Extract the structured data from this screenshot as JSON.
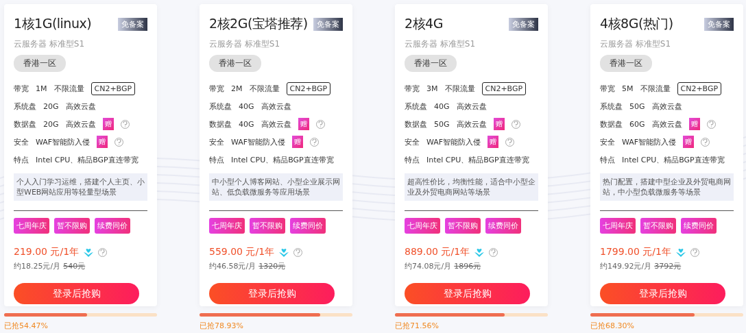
{
  "plans": [
    {
      "title": "1核1G(linux)",
      "badge": "免备案",
      "subtitle": "云服务器 标准型S1",
      "region": "香港一区",
      "specs": [
        {
          "label": "带宽",
          "value": "1M",
          "note": "不限流量",
          "tag": "CN2+BGP"
        },
        {
          "label": "系统盘",
          "value": "20G",
          "note": "高效云盘"
        },
        {
          "label": "数据盘",
          "value": "20G",
          "note": "高效云盘",
          "gift": "赠"
        },
        {
          "label": "安全",
          "value": "WAF智能防入侵",
          "gift": "赠"
        },
        {
          "label": "特点",
          "value": "Intel CPU、精品BGP直连带宽"
        }
      ],
      "description": "个人入门学习运维，搭建个人主页、小型WEB网站应用等轻量型场景",
      "promos": [
        "七周年庆",
        "暂不限购",
        "续费同价"
      ],
      "price": "219.00 元/1年",
      "monthly": "约18.25元/月",
      "original": "540元",
      "button": "登录后抢购",
      "level": 0.5447,
      "sold": "已抢54.47%"
    },
    {
      "title": "2核2G(宝塔推荐)",
      "badge": "免备案",
      "subtitle": "云服务器 标准型S1",
      "region": "香港一区",
      "specs": [
        {
          "label": "带宽",
          "value": "2M",
          "note": "不限流量",
          "tag": "CN2+BGP"
        },
        {
          "label": "系统盘",
          "value": "40G",
          "note": "高效云盘"
        },
        {
          "label": "数据盘",
          "value": "40G",
          "note": "高效云盘",
          "gift": "赠"
        },
        {
          "label": "安全",
          "value": "WAF智能防入侵",
          "gift": "赠"
        },
        {
          "label": "特点",
          "value": "Intel CPU、精品BGP直连带宽"
        }
      ],
      "description": "中小型个人博客网站、小型企业展示网站、低负载微服务等应用场景",
      "promos": [
        "七周年庆",
        "暂不限购",
        "续费同价"
      ],
      "price": "559.00 元/1年",
      "monthly": "约46.58元/月",
      "original": "1320元",
      "button": "登录后抢购",
      "level": 0.7893,
      "sold": "已抢78.93%"
    },
    {
      "title": "2核4G",
      "badge": "免备案",
      "subtitle": "云服务器 标准型S1",
      "region": "香港一区",
      "specs": [
        {
          "label": "带宽",
          "value": "3M",
          "note": "不限流量",
          "tag": "CN2+BGP"
        },
        {
          "label": "系统盘",
          "value": "40G",
          "note": "高效云盘"
        },
        {
          "label": "数据盘",
          "value": "50G",
          "note": "高效云盘",
          "gift": "赠"
        },
        {
          "label": "安全",
          "value": "WAF智能防入侵",
          "gift": "赠"
        },
        {
          "label": "特点",
          "value": "Intel CPU、精品BGP直连带宽"
        }
      ],
      "description": "超高性价比，均衡性能，适合中小型企业及外贸电商网站等场景",
      "promos": [
        "七周年庆",
        "暂不限购",
        "续费同价"
      ],
      "price": "889.00 元/1年",
      "monthly": "约74.08元/月",
      "original": "1896元",
      "button": "登录后抢购",
      "level": 0.7156,
      "sold": "已抢71.56%"
    },
    {
      "title": "4核8G(热门)",
      "badge": "免备案",
      "subtitle": "云服务器 标准型S1",
      "region": "香港一区",
      "specs": [
        {
          "label": "带宽",
          "value": "5M",
          "note": "不限流量",
          "tag": "CN2+BGP"
        },
        {
          "label": "系统盘",
          "value": "50G",
          "note": "高效云盘"
        },
        {
          "label": "数据盘",
          "value": "60G",
          "note": "高效云盘",
          "gift": "赠"
        },
        {
          "label": "安全",
          "value": "WAF智能防入侵",
          "gift": "赠"
        },
        {
          "label": "特点",
          "value": "Intel CPU、精品BGP直连带宽"
        }
      ],
      "description": "热门配置，搭建中型企业及外贸电商网站，中小型负载微服务等场景",
      "promos": [
        "七周年庆",
        "暂不限购",
        "续费同价"
      ],
      "price": "1799.00 元/1年",
      "monthly": "约149.92元/月",
      "original": "3792元",
      "button": "登录后抢购",
      "level": 0.683,
      "sold": "已抢68.30%"
    }
  ]
}
